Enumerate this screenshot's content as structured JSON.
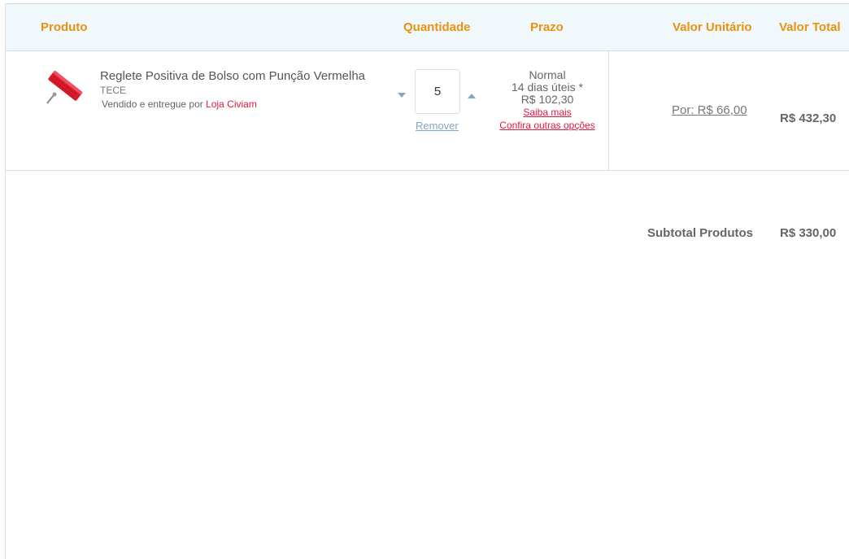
{
  "table": {
    "headers": {
      "product": "Produto",
      "quantity": "Quantidade",
      "deadline": "Prazo",
      "unit_value": "Valor Unitário",
      "total_value": "Valor Total"
    }
  },
  "item": {
    "name": "Reglete Positiva de Bolso com Punção Vermelha",
    "brand": "TECE",
    "seller_prefix": "Vendido e entregue por",
    "seller_name": "Loja Civiam",
    "quantity": "5",
    "remove_label": "Remover",
    "shipping": {
      "type": "Normal",
      "time": "14 dias úteis *",
      "price": "R$ 102,30",
      "more_info_label": "Saiba mais",
      "other_options_label": "Confira outras opções"
    },
    "unit_price": "Por: R$ 66,00",
    "total_price": "R$ 432,30",
    "image_icon": "reglete-product-image"
  },
  "summary": {
    "subtotal_label": "Subtotal Produtos",
    "subtotal_value": "R$ 330,00"
  },
  "colors": {
    "accent": "#e8920f",
    "link_red": "#e3173e",
    "link_blue": "#7fa9c2",
    "header_bg": "#f1f8fc",
    "border": "#cfdfe8"
  }
}
